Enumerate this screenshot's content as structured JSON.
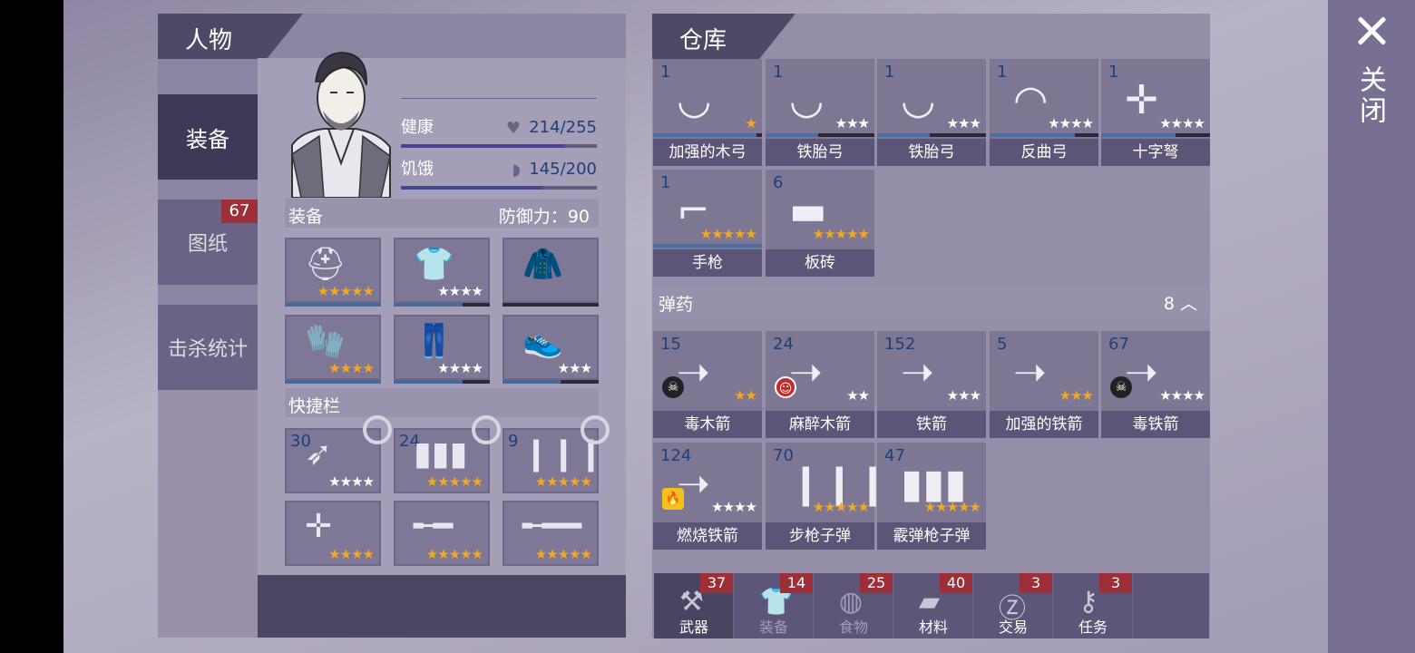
{
  "close_label": "关闭",
  "character": {
    "title": "人物",
    "tabs": [
      {
        "label": "装备"
      },
      {
        "label": "图纸",
        "badge": "67"
      },
      {
        "label": "击杀统计"
      }
    ],
    "health": {
      "label": "健康",
      "value": "214/255",
      "fraction": 0.84
    },
    "hunger": {
      "label": "饥饿",
      "value": "145/200",
      "fraction": 0.725
    },
    "equipment": {
      "label": "装备",
      "defense_label": "防御力：",
      "defense_value": "90"
    },
    "quickbar": {
      "label": "快捷栏"
    },
    "equip_slots": [
      {
        "icon": "helmet-icon",
        "stars": 5,
        "star_color": "gold",
        "durability": 1.0
      },
      {
        "icon": "shirt-icon",
        "stars": 4,
        "star_color": "white",
        "durability": 0.72
      },
      {
        "icon": "jacket-icon",
        "stars": 0,
        "star_color": "white",
        "durability": 0
      },
      {
        "icon": "gloves-icon",
        "stars": 4,
        "star_color": "gold",
        "durability": 1.0
      },
      {
        "icon": "pants-icon",
        "stars": 4,
        "star_color": "white",
        "durability": 0.72
      },
      {
        "icon": "shoes-icon",
        "stars": 3,
        "star_color": "white",
        "durability": 0.6
      }
    ],
    "quick_slots": [
      {
        "icon": "poison-arrow-icon",
        "count": "30",
        "stars": 4,
        "star_color": "white"
      },
      {
        "icon": "shotgun-shells-icon",
        "count": "24",
        "stars": 5,
        "star_color": "gold"
      },
      {
        "icon": "rifle-bullets-icon",
        "count": "9",
        "stars": 5,
        "star_color": "gold"
      },
      {
        "icon": "crossbow-icon",
        "count": "",
        "stars": 4,
        "star_color": "gold"
      },
      {
        "icon": "shotgun-icon",
        "count": "",
        "stars": 5,
        "star_color": "gold"
      },
      {
        "icon": "rifle-icon",
        "count": "",
        "stars": 5,
        "star_color": "gold"
      }
    ]
  },
  "warehouse": {
    "title": "仓库",
    "weapons": [
      {
        "name": "加强的木弓",
        "count": "1",
        "stars": 1,
        "star_color": "gold",
        "durability": 0.95,
        "icon": "bow-icon"
      },
      {
        "name": "铁胎弓",
        "count": "1",
        "stars": 3,
        "star_color": "white",
        "durability": 0.48,
        "icon": "bow-icon"
      },
      {
        "name": "铁胎弓",
        "count": "1",
        "stars": 3,
        "star_color": "white",
        "durability": 0.48,
        "icon": "bow-icon"
      },
      {
        "name": "反曲弓",
        "count": "1",
        "stars": 4,
        "star_color": "white",
        "durability": 0.78,
        "icon": "recurve-bow-icon"
      },
      {
        "name": "十字弩",
        "count": "1",
        "stars": 4,
        "star_color": "white",
        "durability": 0.68,
        "icon": "crossbow-icon"
      },
      {
        "name": "手枪",
        "count": "1",
        "stars": 5,
        "star_color": "gold",
        "durability": 1.0,
        "icon": "revolver-icon"
      },
      {
        "name": "板砖",
        "count": "6",
        "stars": 5,
        "star_color": "gold",
        "durability": 0,
        "icon": "brick-icon"
      }
    ],
    "ammo_section": {
      "label": "弹药",
      "count": "8"
    },
    "ammo": [
      {
        "name": "毒木箭",
        "count": "15",
        "stars": 2,
        "star_color": "gold",
        "badge": "poison",
        "icon": "arrow-icon"
      },
      {
        "name": "麻醉木箭",
        "count": "24",
        "stars": 2,
        "star_color": "white",
        "badge": "sedative",
        "icon": "arrow-icon"
      },
      {
        "name": "铁箭",
        "count": "152",
        "stars": 3,
        "star_color": "white",
        "badge": "",
        "icon": "arrow-icon"
      },
      {
        "name": "加强的铁箭",
        "count": "5",
        "stars": 3,
        "star_color": "gold",
        "badge": "",
        "icon": "arrow-icon"
      },
      {
        "name": "毒铁箭",
        "count": "67",
        "stars": 4,
        "star_color": "white",
        "badge": "poison",
        "icon": "arrow-icon"
      },
      {
        "name": "燃烧铁箭",
        "count": "124",
        "stars": 4,
        "star_color": "white",
        "badge": "fire",
        "icon": "arrow-icon"
      },
      {
        "name": "步枪子弹",
        "count": "70",
        "stars": 5,
        "star_color": "gold",
        "badge": "",
        "icon": "rifle-bullets-icon"
      },
      {
        "name": "霰弹枪子弹",
        "count": "47",
        "stars": 5,
        "star_color": "gold",
        "badge": "",
        "icon": "shotgun-shells-icon"
      }
    ],
    "categories": [
      {
        "label": "武器",
        "count": "37",
        "icon": "weapon-icon"
      },
      {
        "label": "装备",
        "count": "14",
        "icon": "shirt-icon"
      },
      {
        "label": "食物",
        "count": "25",
        "icon": "food-icon"
      },
      {
        "label": "材料",
        "count": "40",
        "icon": "material-icon"
      },
      {
        "label": "交易",
        "count": "3",
        "icon": "coin-icon"
      },
      {
        "label": "任务",
        "count": "3",
        "icon": "key-icon"
      }
    ]
  }
}
